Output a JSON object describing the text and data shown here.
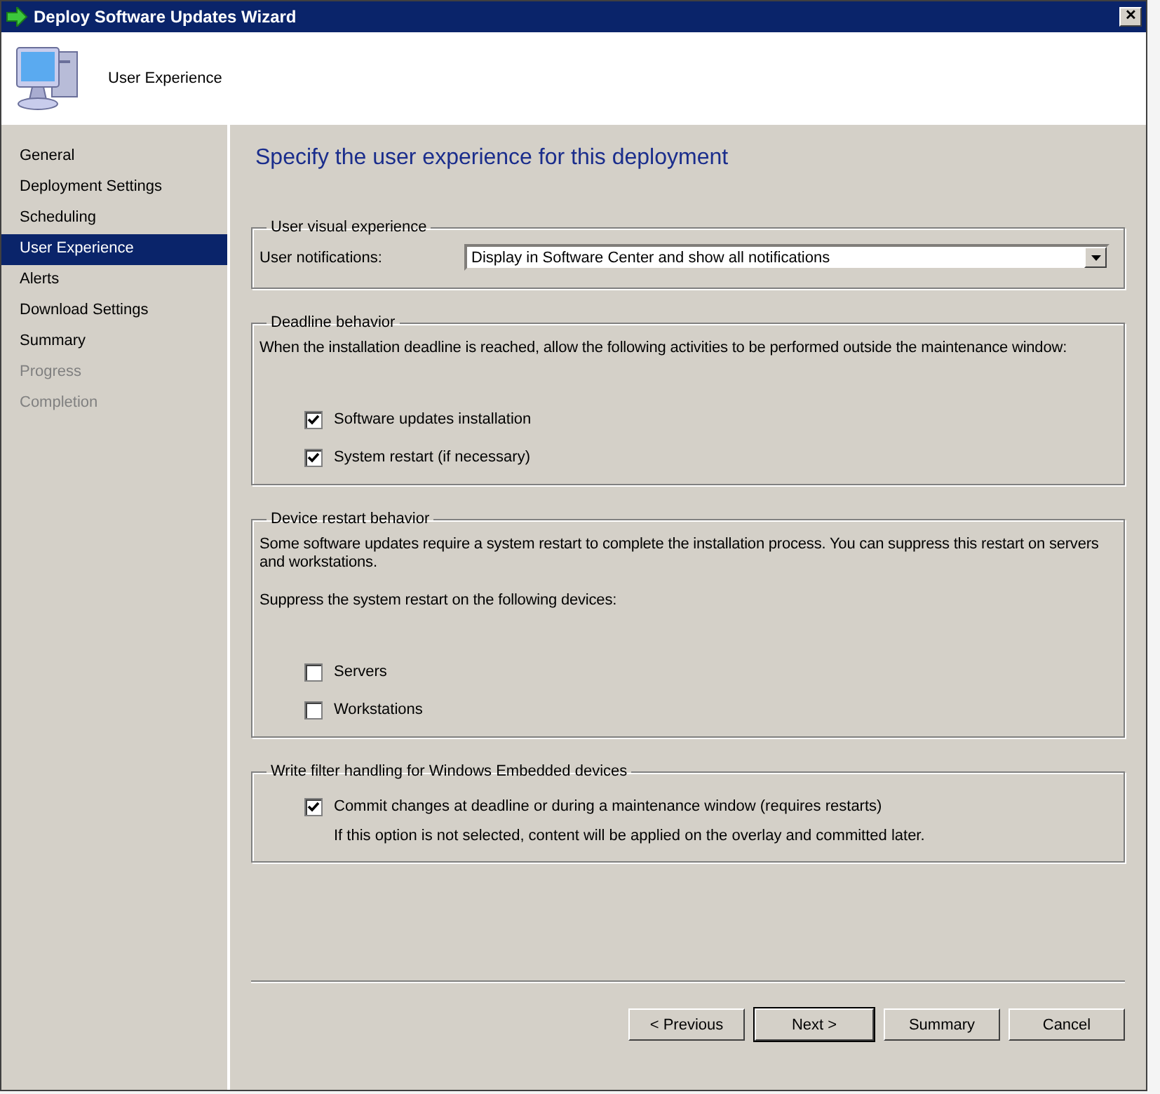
{
  "window": {
    "title": "Deploy Software Updates Wizard",
    "close": "✕"
  },
  "header": {
    "title": "User Experience"
  },
  "sidebar": {
    "items": [
      {
        "label": "General",
        "selected": false,
        "disabled": false
      },
      {
        "label": "Deployment Settings",
        "selected": false,
        "disabled": false
      },
      {
        "label": "Scheduling",
        "selected": false,
        "disabled": false
      },
      {
        "label": "User Experience",
        "selected": true,
        "disabled": false
      },
      {
        "label": "Alerts",
        "selected": false,
        "disabled": false
      },
      {
        "label": "Download Settings",
        "selected": false,
        "disabled": false
      },
      {
        "label": "Summary",
        "selected": false,
        "disabled": false
      },
      {
        "label": "Progress",
        "selected": false,
        "disabled": true
      },
      {
        "label": "Completion",
        "selected": false,
        "disabled": true
      }
    ]
  },
  "page_heading": "Specify the user experience for this deployment",
  "groups": [
    {
      "legend": "User visual experience",
      "items": [
        {
          "kind": "dropdown",
          "label": "User notifications:",
          "value": "Display in Software Center and show all notifications"
        }
      ]
    },
    {
      "legend": "Deadline behavior",
      "items": [
        {
          "kind": "text",
          "text": "When the installation deadline is reached, allow the following activities to be performed outside the maintenance window:"
        },
        {
          "kind": "checkbox",
          "label": "Software updates installation",
          "checked": true
        },
        {
          "kind": "checkbox",
          "label": "System restart (if necessary)",
          "checked": true
        }
      ]
    },
    {
      "legend": "Device restart behavior",
      "items": [
        {
          "kind": "text",
          "text": "Some software updates require a system restart to complete the installation process. You can suppress this restart on servers and workstations."
        },
        {
          "kind": "text",
          "text": "Suppress the system restart on the following devices:"
        },
        {
          "kind": "checkbox",
          "label": "Servers",
          "checked": false
        },
        {
          "kind": "checkbox",
          "label": "Workstations",
          "checked": false
        }
      ]
    },
    {
      "legend": "Write filter handling for Windows Embedded devices",
      "items": [
        {
          "kind": "checkbox",
          "label": "Commit changes at deadline or during a maintenance window (requires restarts)",
          "checked": true
        },
        {
          "kind": "note",
          "text": "If this option is not selected, content will be applied on the overlay and committed later."
        }
      ]
    }
  ],
  "buttons": [
    {
      "label": "< Previous",
      "default": false
    },
    {
      "label": "Next >",
      "default": true
    },
    {
      "label": "Summary",
      "default": false
    },
    {
      "label": "Cancel",
      "default": false
    }
  ]
}
